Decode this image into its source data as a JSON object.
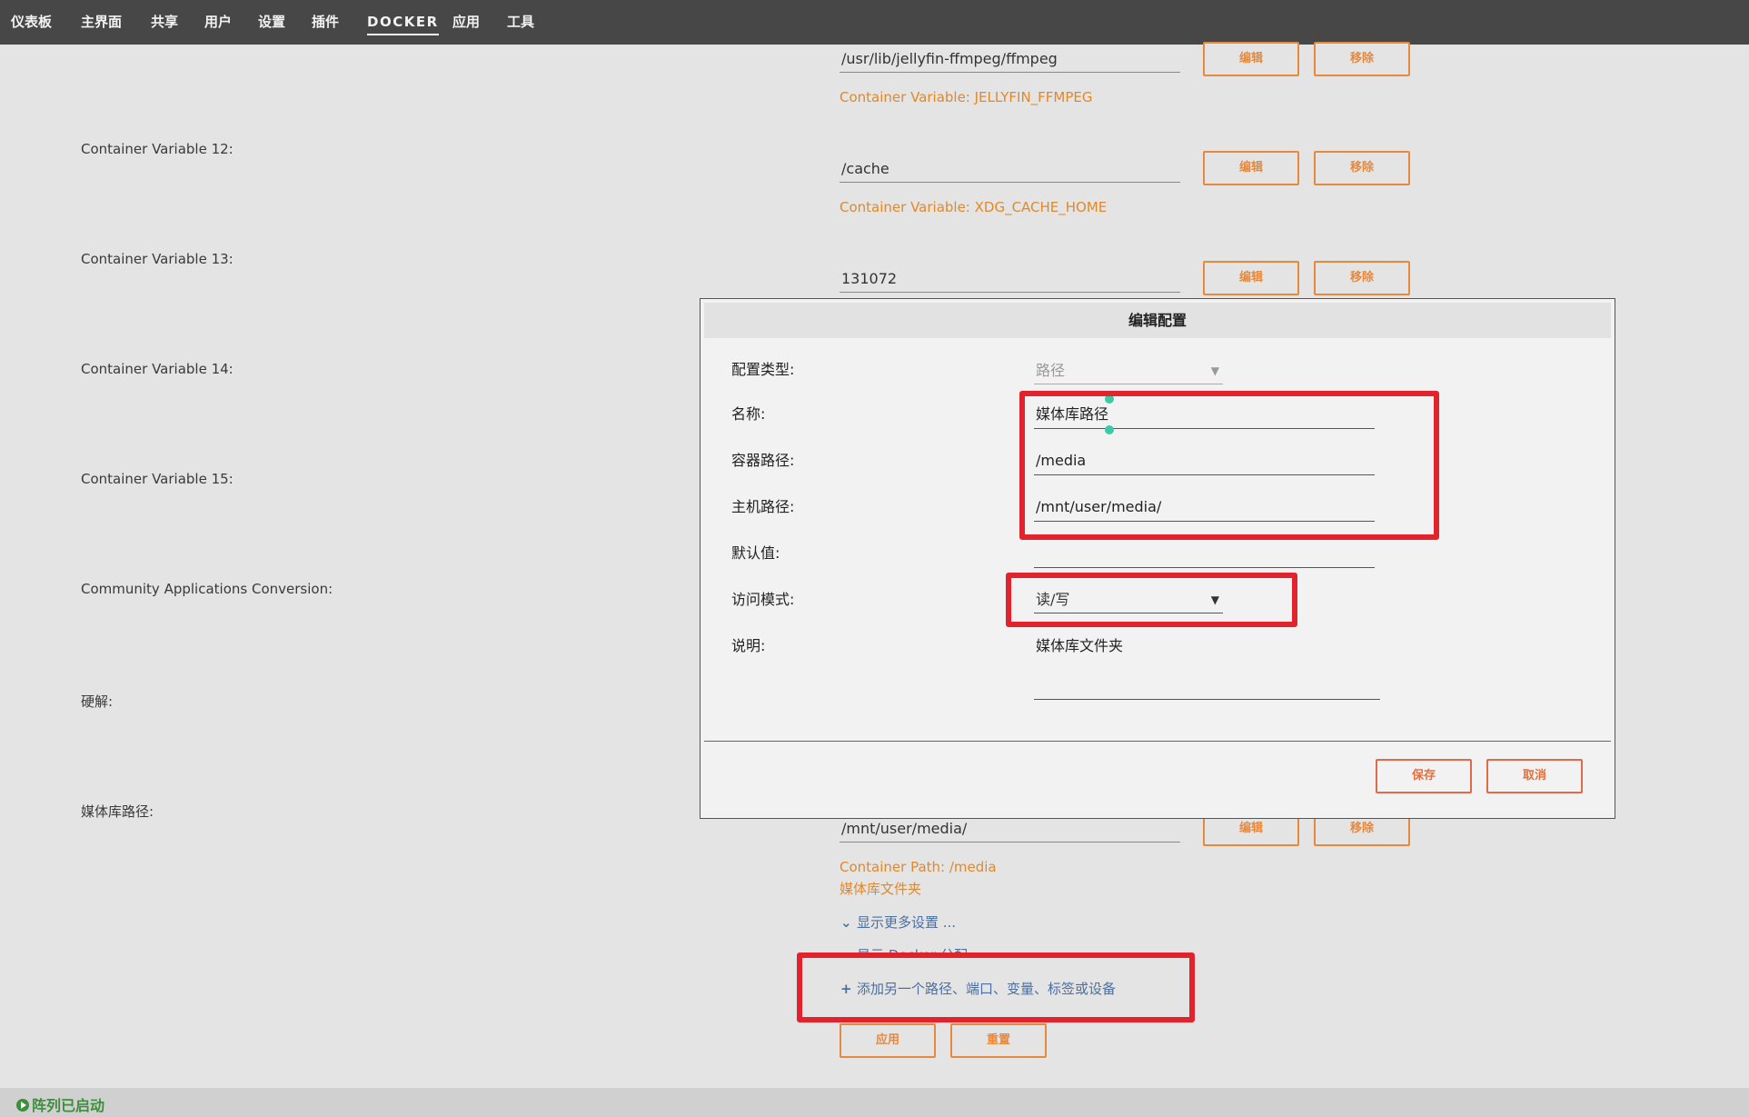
{
  "nav": {
    "items": [
      "仪表板",
      "主界面",
      "共享",
      "用户",
      "设置",
      "插件",
      "DOCKER",
      "应用",
      "工具"
    ],
    "active": "DOCKER"
  },
  "buttons": {
    "edit": "编辑",
    "remove": "移除",
    "apply": "应用",
    "reset": "重置"
  },
  "rows": {
    "ffmpeg": {
      "value": "/usr/lib/jellyfin-ffmpeg/ffmpeg",
      "hint": "Container Variable: JELLYFIN_FFMPEG"
    },
    "var12": {
      "label": "Container Variable 12:",
      "value": "/cache",
      "hint": "Container Variable: XDG_CACHE_HOME"
    },
    "var13": {
      "label": "Container Variable 13:",
      "value": "131072"
    },
    "var14": {
      "label": "Container Variable 14:"
    },
    "var15": {
      "label": "Container Variable 15:"
    },
    "ca_conversion": {
      "label": "Community Applications Conversion:"
    },
    "hw": {
      "label": "硬解:"
    },
    "media": {
      "label": "媒体库路径:",
      "value": "/mnt/user/media/",
      "hint": "Container Path: /media",
      "desc": "媒体库文件夹"
    }
  },
  "links": {
    "more_settings": "显示更多设置 ...",
    "docker_partial": "显示 Docker 分配",
    "add_another": "添加另一个路径、端口、变量、标签或设备"
  },
  "status": {
    "array": "阵列已启动"
  },
  "dialog": {
    "title": "编辑配置",
    "labels": {
      "type": "配置类型:",
      "name": "名称:",
      "container_path": "容器路径:",
      "host_path": "主机路径:",
      "default": "默认值:",
      "access_mode": "访问模式:",
      "description": "说明:"
    },
    "values": {
      "type": "路径",
      "name": "媒体库路径",
      "container_path": "/media",
      "host_path": "/mnt/user/media/",
      "default": "",
      "access_mode": "读/写",
      "description": "媒体库文件夹"
    },
    "save": "保存",
    "cancel": "取消"
  },
  "colors": {
    "accent": "#e6893d",
    "highlight": "#e0232d",
    "status_ok": "#3d8f3d",
    "link": "#4a6fa0"
  },
  "icons": {
    "dropdown": "caret-down-icon",
    "expand": "chevron-down-icon",
    "add": "plus-icon",
    "status": "play-circle-icon"
  }
}
